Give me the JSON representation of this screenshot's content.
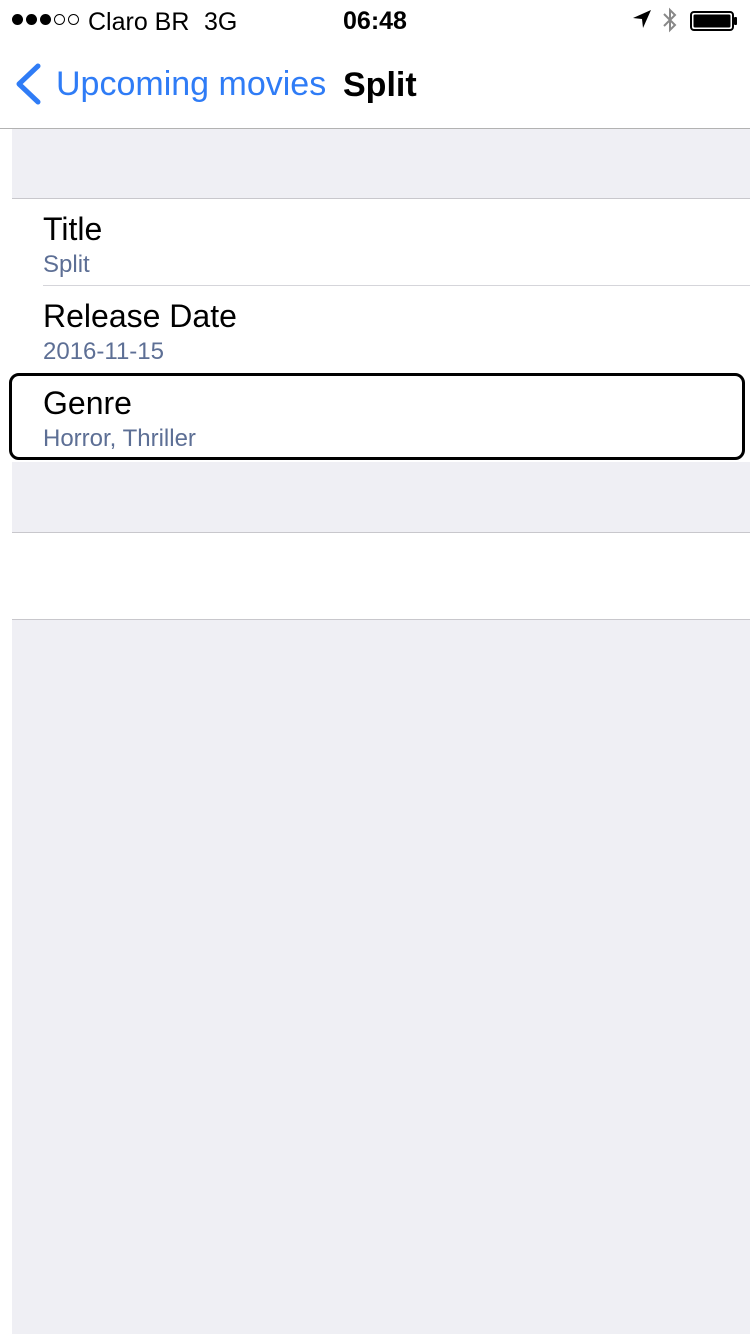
{
  "status_bar": {
    "carrier": "Claro BR",
    "network": "3G",
    "time": "06:48",
    "signal_bars": 3,
    "signal_max": 5
  },
  "nav": {
    "back_label": "Upcoming movies",
    "title": "Split",
    "accent_color": "#2f7cf6"
  },
  "details": [
    {
      "label": "Title",
      "value": "Split"
    },
    {
      "label": "Release Date",
      "value": "2016-11-15"
    },
    {
      "label": "Genre",
      "value": "Horror, Thriller"
    }
  ],
  "icons": {
    "location": "location-arrow-icon",
    "bluetooth": "bluetooth-icon",
    "battery": "battery-icon",
    "back": "chevron-left-icon"
  }
}
